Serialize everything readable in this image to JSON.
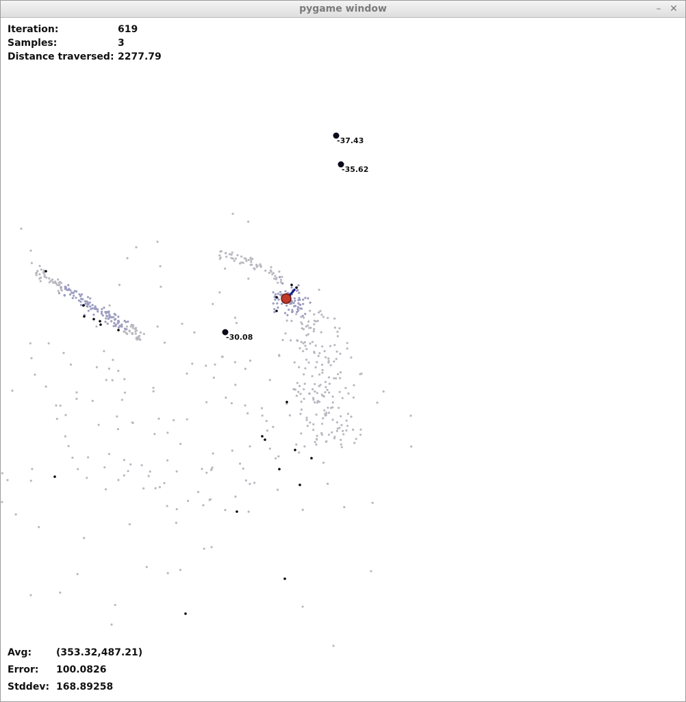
{
  "window": {
    "title": "pygame window",
    "minimize_glyph": "–",
    "close_glyph": "✕"
  },
  "stats_top": {
    "iteration_label": "Iteration:",
    "iteration_value": "619",
    "samples_label": "Samples:",
    "samples_value": "3",
    "distance_label": "Distance traversed:",
    "distance_value": "2277.79"
  },
  "stats_bottom": {
    "avg_label": "Avg:",
    "avg_value": "(353.32,487.21)",
    "error_label": "Error:",
    "error_value": "100.0826",
    "stddev_label": "Stddev:",
    "stddev_value": "168.89258"
  },
  "landmarks": [
    {
      "label": "-37.43"
    },
    {
      "label": "-35.62"
    },
    {
      "label": "-30.08"
    }
  ],
  "colors": {
    "particle": "#b8b8c0",
    "particle_dense": "#9c9cc0",
    "sample": "#000000",
    "robot": "#c0392b",
    "heading": "#1a1a8c"
  }
}
